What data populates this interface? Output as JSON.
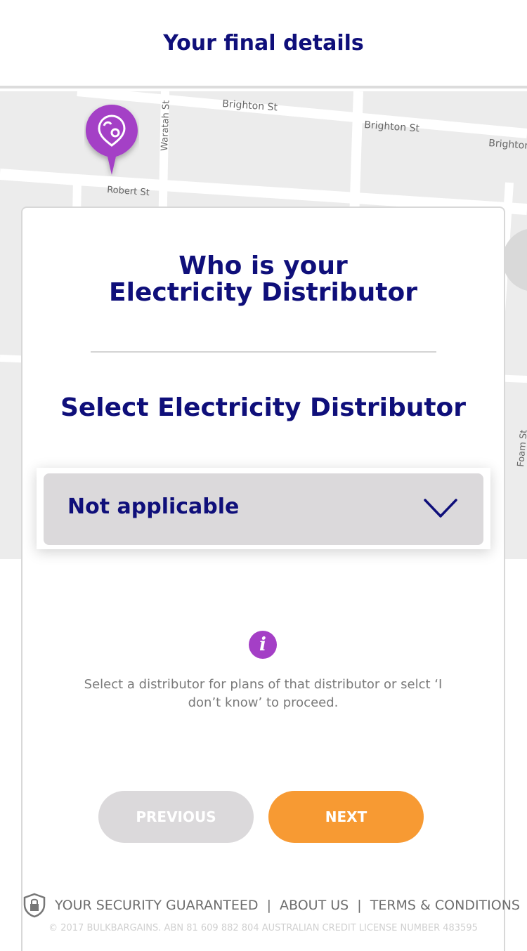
{
  "header": {
    "title": "Your final details"
  },
  "map": {
    "streets": [
      "Brighton St",
      "Brighton St",
      "Brighton",
      "Waratah St",
      "Robert St",
      "Foam St"
    ],
    "pin_icon": "location-pin-icon",
    "pin_color": "#a43fc6"
  },
  "card": {
    "question_line1": "Who is your",
    "question_line2": "Electricity Distributor",
    "select_heading": "Select Electricity Distributor",
    "select": {
      "value": "Not applicable",
      "icon": "chevron-down-icon"
    },
    "info": {
      "icon": "info-icon",
      "icon_glyph": "i",
      "text": "Select a distributor for plans of that distributor or selct ‘I don’t know’ to proceed."
    },
    "buttons": {
      "previous": "PREVIOUS",
      "next": "NEXT"
    }
  },
  "footer": {
    "security": "YOUR SECURITY GUARANTEED",
    "about": "ABOUT US",
    "terms": "TERMS & CONDITIONS",
    "separator": "|",
    "copyright": "© 2017 BULKBARGAINS. ABN 81 609 882 804 AUSTRALIAN CREDIT LICENSE NUMBER 483595"
  },
  "colors": {
    "brand_navy": "#0f0f7a",
    "accent_purple": "#a43fc6",
    "next_orange": "#f79a33",
    "disabled_grey": "#dbd9db"
  }
}
